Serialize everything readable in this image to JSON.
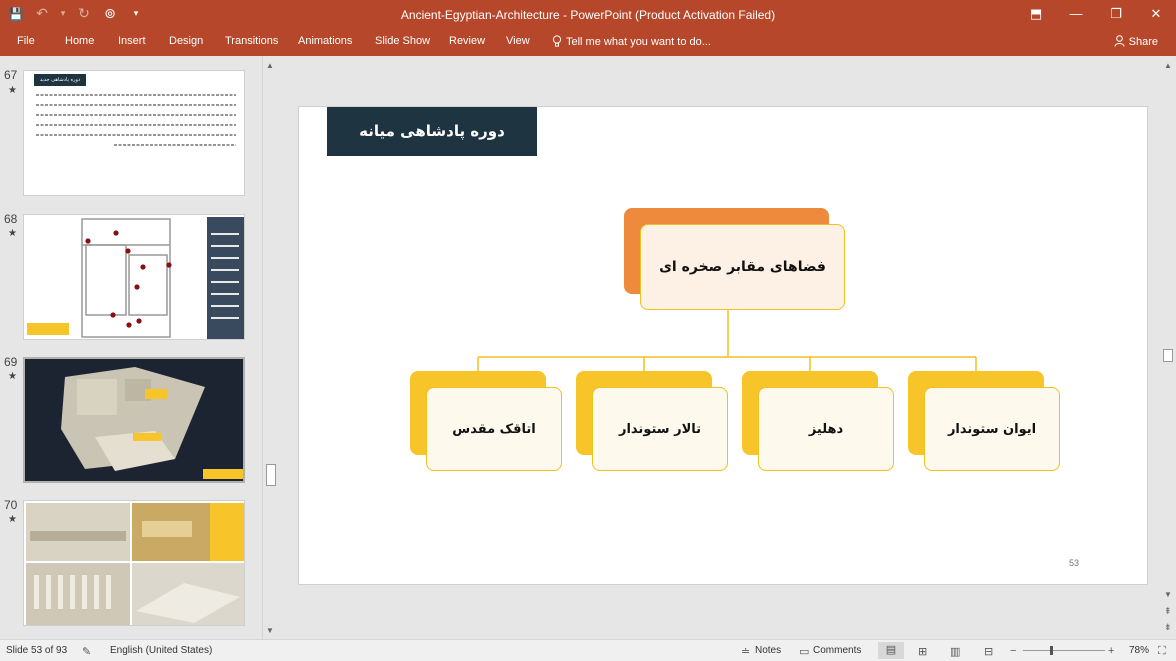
{
  "window": {
    "title": "Ancient-Egyptian-Architecture - PowerPoint (Product Activation Failed)",
    "controls": {
      "restore_ribbon": "⬒",
      "minimize": "—",
      "maximize": "❐",
      "close": "✕"
    }
  },
  "qat": {
    "save": "💾",
    "undo": "↶",
    "undo_menu": "▾",
    "redo": "↻",
    "present": "⊚",
    "customize": "▾"
  },
  "ribbon": {
    "tabs": [
      "File",
      "Home",
      "Insert",
      "Design",
      "Transitions",
      "Animations",
      "Slide Show",
      "Review",
      "View"
    ],
    "tell_me": "Tell me what you want to do...",
    "share": "Share"
  },
  "thumbnails": {
    "items": [
      {
        "number": "67",
        "star": "★"
      },
      {
        "number": "68",
        "star": "★"
      },
      {
        "number": "69",
        "star": "★"
      },
      {
        "number": "70",
        "star": "★"
      }
    ],
    "slide67_title": "دوره پادشاهی جدید"
  },
  "slide": {
    "title": "دوره پادشاهی میانه",
    "root": "فضاهای مقابر صخره ای",
    "children": [
      "ایوان ستوندار",
      "دهلیز",
      "تالار ستوندار",
      "اتاقک مقدس"
    ],
    "page_number": "53",
    "colors": {
      "root": "#ee8a3b",
      "child": "#f7c52a",
      "connector": "#f0c020",
      "title_bg": "#1e3440"
    }
  },
  "status": {
    "slide_info": "Slide 53 of 93",
    "language": "English (United States)",
    "notes": "Notes",
    "comments": "Comments",
    "zoom": "78%"
  }
}
